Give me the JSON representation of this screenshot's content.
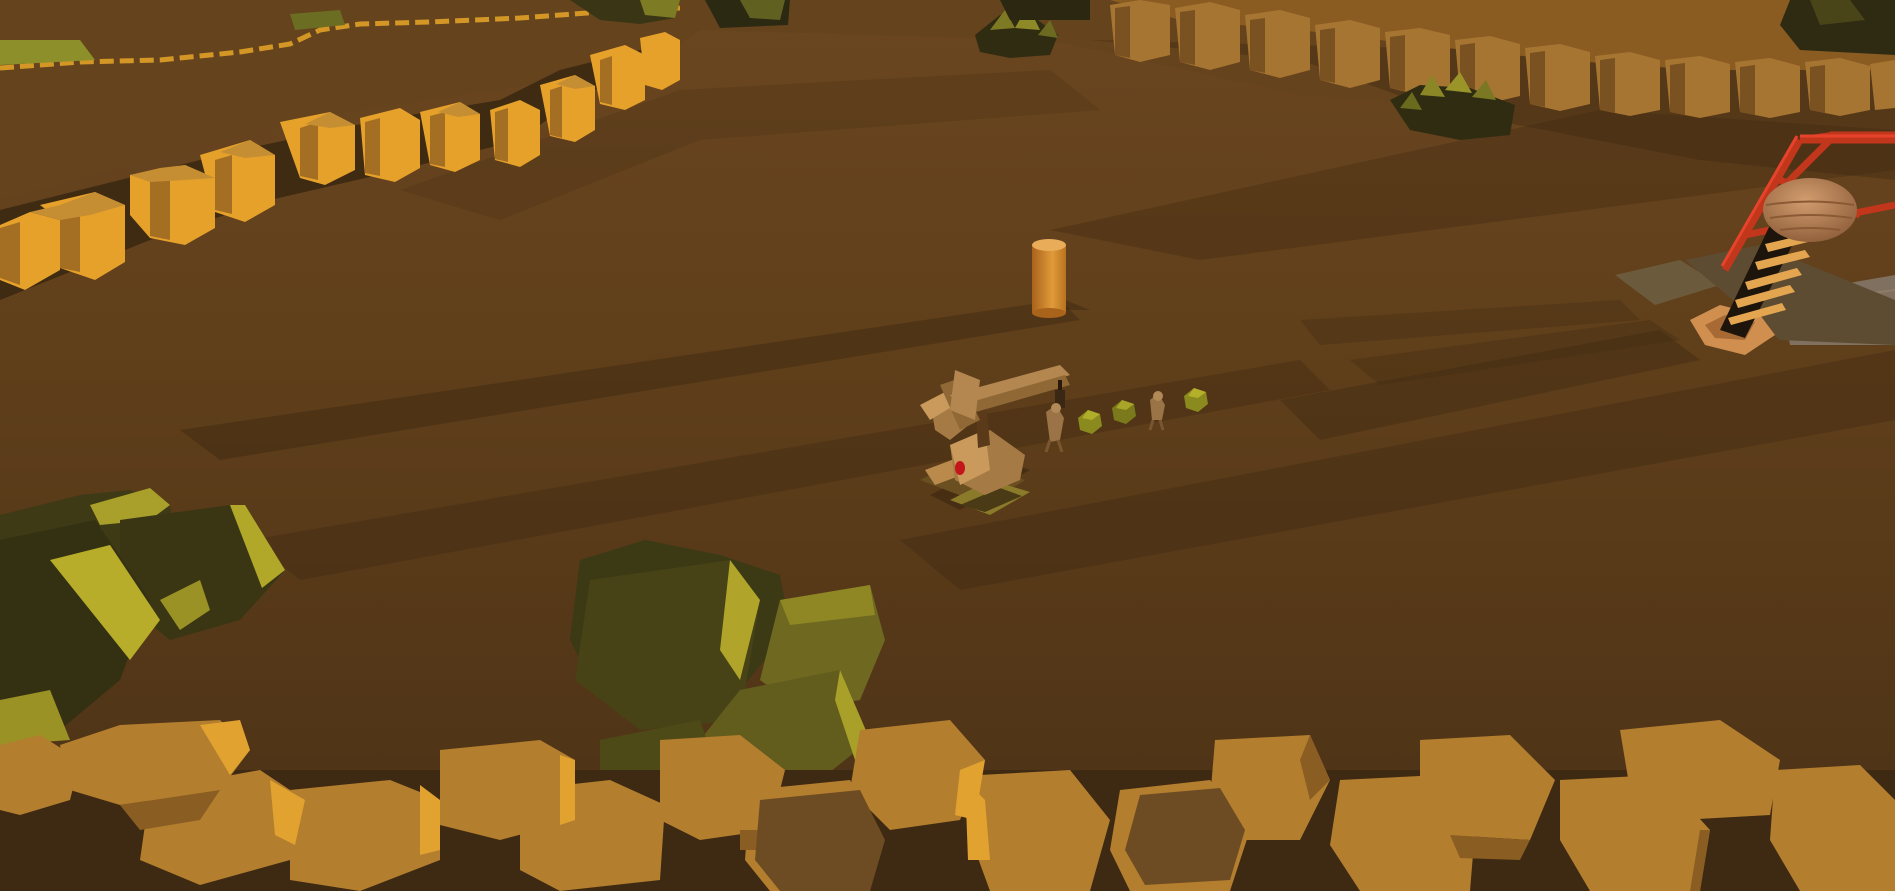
{
  "scene": {
    "type": "3d-game-viewport",
    "hud_text": "none visible",
    "colors": {
      "ground": "#5e3e1a",
      "ground_dark": "#4a3016",
      "cliff_lit": "#e5a12a",
      "cliff_side": "#9c6a22",
      "cliff_top": "#b6872f",
      "rock_dark": "#3e3a16",
      "rock_lit": "#a39a25",
      "tower_frame": "#c2361c",
      "tower_cap": "#b57e56",
      "unit_body": "#a77b45",
      "unit_marker": "#c4151a",
      "pillar": "#d0862c",
      "shadow": "#3a250f"
    },
    "objects": [
      "hexagonal-cliff-ridge-left",
      "hexagonal-cliff-ridge-top-right",
      "hexagonal-rock-ledge-foreground",
      "mossy-boulder-cluster-left",
      "mossy-boulder-cluster-center",
      "shrub-top-center",
      "shrub-top-right",
      "red-lattice-tower-with-screw",
      "cylindrical-pillar",
      "crane-robot-unit",
      "small-creature-group"
    ]
  }
}
